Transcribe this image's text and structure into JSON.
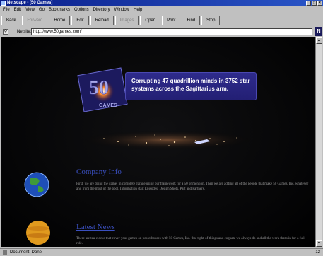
{
  "window": {
    "title": "Netscape - [50 Games]"
  },
  "menu": [
    "File",
    "Edit",
    "View",
    "Go",
    "Bookmarks",
    "Options",
    "Directory",
    "Window",
    "Help"
  ],
  "toolbar": [
    "Back",
    "Forward",
    "Home",
    "Edit",
    "Reload",
    "Images",
    "Open",
    "Print",
    "Find",
    "Stop"
  ],
  "address": {
    "label": "Netsite:",
    "value": "http://www.50games.com/"
  },
  "page": {
    "logo_text": "50 GAMES",
    "banner_text": "Corrupting 47 quadrillion minds in 3752 star systems across the Sagittarius arm.",
    "section1": {
      "title": "Company Info",
      "text": "First, we are doing the game: in complete garage using our framework for a 50 or mention. Then we are adding all of the people that make 50 Games, Inc. whatever and from the most of the pool. Information start Episodes, Design Shots, Part and Partners."
    },
    "section2": {
      "title": "Latest News",
      "text": "There are tea-clocks that cover your games on powerhouses with 50 Games, Inc. that tight-of things and cognate we always do and all the work that's in for a full ride."
    }
  },
  "status": {
    "text": "Document: Done",
    "right": "12"
  },
  "colors": {
    "title_bar": "#0a1e8a",
    "banner": "#2e2b8c",
    "link": "#3a4fbf"
  }
}
